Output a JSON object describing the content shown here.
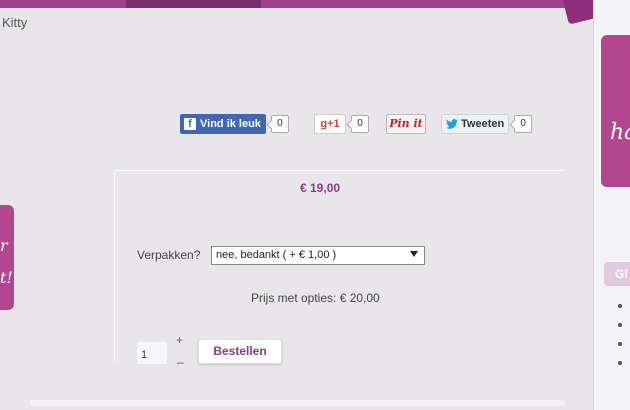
{
  "breadcrumb": {
    "current": "Kitty"
  },
  "social": {
    "facebook": {
      "label": "Vind ik leuk",
      "count": "0"
    },
    "gplus": {
      "label": "g+1",
      "count": "0"
    },
    "pinterest": {
      "label": "Pin it"
    },
    "twitter": {
      "label": "Tweeten",
      "count": "0"
    }
  },
  "product": {
    "price": "€ 19,00",
    "wrap_label": "Verpakken?",
    "wrap_selected": "nee, bedankt ( + € 1,00 )",
    "total_with_options": "Prijs met opties: € 20,00",
    "quantity": "1",
    "plus": "+",
    "minus": "–",
    "order_label": "Bestellen"
  },
  "right_sidebar": {
    "banner_text": "ha",
    "tab_label": "Gl"
  },
  "left_banner": {
    "text_top": "r",
    "text_bottom": "t!"
  },
  "colors": {
    "accent": "#8b3a86",
    "topbar": "#a0418c",
    "facebook": "#4267b2"
  }
}
